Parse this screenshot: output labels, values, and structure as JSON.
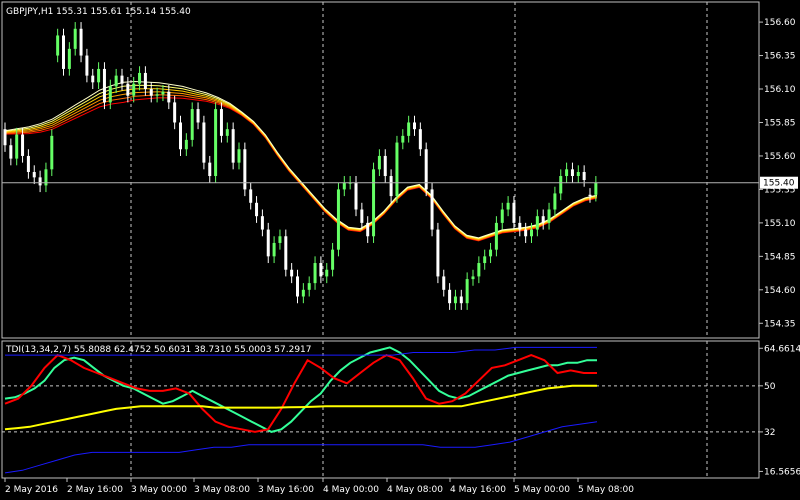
{
  "symbol_line": "GBPJPY,H1  155.31 155.61 155.14 155.40",
  "indicator_line": "TDI(13,34,2,7) 55.8088 62.4752 50.6031 38.7310 55.0003 57.2917",
  "colors": {
    "background": "#000000",
    "frame": "#c0c0c0",
    "grid": "#c8c8c8",
    "bull": "#66ff66",
    "bear": "#ffffff",
    "ribbon": [
      "#ff0000",
      "#ff6600",
      "#ff9900",
      "#ffcc00",
      "#ffff66",
      "#ffffcc"
    ],
    "tdi_green": "#33ff99",
    "tdi_red": "#ff0000",
    "tdi_yellow": "#ffff00",
    "tdi_band": "#1a1aff",
    "price_line": "#b4b4b4"
  },
  "price_axis": {
    "min": 154.24,
    "max": 156.75,
    "ticks": [
      "156.60",
      "156.35",
      "156.10",
      "155.85",
      "155.60",
      "155.35",
      "155.10",
      "154.85",
      "154.60",
      "154.35"
    ],
    "current": "155.40"
  },
  "tdi_axis": {
    "min": 14.0,
    "max": 67.5,
    "ticks": [
      "64.6614",
      "50",
      "32",
      "16.5656"
    ]
  },
  "time_labels": [
    "2 May 2016",
    "2 May 16:00",
    "3 May 00:00",
    "3 May 08:00",
    "3 May 16:00",
    "4 May 00:00",
    "4 May 08:00",
    "4 May 16:00",
    "5 May 00:00",
    "5 May 08:00"
  ],
  "chart_data": [
    {
      "type": "candlestick",
      "title": "GBPJPY,H1",
      "ylim": [
        154.24,
        156.75
      ],
      "closes": [
        155.68,
        155.58,
        155.76,
        155.6,
        155.48,
        155.44,
        155.38,
        155.5,
        155.75,
        156.5,
        156.25,
        156.4,
        156.55,
        156.35,
        156.2,
        156.15,
        156.25,
        156.0,
        156.12,
        156.2,
        156.14,
        156.05,
        156.14,
        156.22,
        156.1,
        156.05,
        156.06,
        156.08,
        156.0,
        155.85,
        155.65,
        155.72,
        155.95,
        155.85,
        155.55,
        155.45,
        155.95,
        155.75,
        155.8,
        155.55,
        155.65,
        155.35,
        155.25,
        155.15,
        155.05,
        154.85,
        154.95,
        155.0,
        154.75,
        154.7,
        154.55,
        154.6,
        154.65,
        154.8,
        154.7,
        154.75,
        154.9,
        155.35,
        155.4,
        155.4,
        155.2,
        155.1,
        155.0,
        155.5,
        155.6,
        155.45,
        155.3,
        155.7,
        155.75,
        155.85,
        155.8,
        155.65,
        155.35,
        155.05,
        154.7,
        154.6,
        154.5,
        154.55,
        154.5,
        154.68,
        154.7,
        154.8,
        154.85,
        154.9,
        155.1,
        155.2,
        155.25,
        155.1,
        155.05,
        155.0,
        155.05,
        155.15,
        155.1,
        155.2,
        155.32,
        155.45,
        155.5,
        155.45,
        155.48,
        155.42,
        155.3,
        155.4
      ],
      "opens": [
        155.8,
        155.68,
        155.58,
        155.76,
        155.6,
        155.48,
        155.44,
        155.38,
        155.5,
        156.35,
        156.5,
        156.25,
        156.4,
        156.55,
        156.35,
        156.2,
        156.15,
        156.25,
        156.0,
        156.12,
        156.2,
        156.14,
        156.05,
        156.14,
        156.22,
        156.1,
        156.05,
        156.06,
        156.08,
        156.0,
        155.85,
        155.65,
        155.72,
        155.95,
        155.85,
        155.55,
        155.45,
        155.95,
        155.75,
        155.8,
        155.55,
        155.65,
        155.35,
        155.25,
        155.15,
        155.05,
        154.85,
        154.95,
        155.0,
        154.75,
        154.7,
        154.55,
        154.6,
        154.65,
        154.8,
        154.7,
        154.75,
        154.9,
        155.35,
        155.4,
        155.4,
        155.2,
        155.1,
        155.0,
        155.5,
        155.6,
        155.45,
        155.3,
        155.7,
        155.75,
        155.85,
        155.8,
        155.65,
        155.35,
        155.05,
        154.7,
        154.6,
        154.5,
        154.55,
        154.5,
        154.68,
        154.7,
        154.8,
        154.85,
        154.9,
        155.1,
        155.2,
        155.25,
        155.1,
        155.05,
        155.0,
        155.05,
        155.15,
        155.1,
        155.2,
        155.32,
        155.45,
        155.5,
        155.45,
        155.48,
        155.31,
        155.31
      ],
      "ribbon_center": [
        155.78,
        155.79,
        155.8,
        155.82,
        155.85,
        155.9,
        155.95,
        156.0,
        156.05,
        156.08,
        156.1,
        156.11,
        156.11,
        156.11,
        156.1,
        156.09,
        156.07,
        156.05,
        156.02,
        155.98,
        155.92,
        155.85,
        155.75,
        155.62,
        155.5,
        155.4,
        155.3,
        155.2,
        155.12,
        155.06,
        155.05,
        155.1,
        155.18,
        155.28,
        155.36,
        155.38,
        155.3,
        155.18,
        155.07,
        155.0,
        154.98,
        155.01,
        155.04,
        155.05,
        155.06,
        155.08,
        155.12,
        155.18,
        155.24,
        155.28,
        155.3
      ]
    },
    {
      "type": "line",
      "title": "TDI(13,34,2,7)",
      "ylim": [
        14.0,
        67.5
      ],
      "series": [
        {
          "values": [
            45,
            45.5,
            47,
            49,
            52,
            57,
            60,
            61,
            60,
            57,
            54,
            52,
            50,
            49,
            47,
            45,
            43,
            44,
            46,
            48,
            46,
            44,
            42,
            40,
            38,
            36,
            34,
            32,
            33,
            36,
            40,
            44,
            47,
            52,
            56,
            59,
            61,
            63,
            64,
            65,
            63,
            60,
            56,
            52,
            48,
            46,
            45,
            46,
            48,
            50,
            52,
            54,
            55,
            56,
            57,
            58,
            58,
            59,
            59,
            60,
            60
          ]
        },
        {
          "values": [
            43,
            45,
            50,
            57,
            62,
            60,
            57,
            55,
            53,
            51,
            49,
            48,
            48,
            49,
            47,
            41,
            36,
            34,
            33,
            32,
            33,
            41,
            51,
            60,
            57,
            53,
            51,
            55,
            59,
            62,
            60,
            53,
            45,
            43,
            44,
            47,
            52,
            57,
            58,
            60,
            62,
            60,
            55,
            56,
            55,
            55
          ]
        },
        {
          "values": [
            33,
            33.5,
            34,
            35,
            36,
            37,
            38,
            39,
            40,
            41,
            41.5,
            42,
            42,
            42,
            42,
            42,
            42,
            41.5,
            41.5,
            41.5,
            41.5,
            41.5,
            41.5,
            41.6,
            41.7,
            41.8,
            42,
            42,
            42,
            42,
            42,
            42,
            42,
            42,
            42,
            42,
            42,
            42,
            43,
            44,
            45,
            46,
            47,
            48,
            49,
            49.5,
            50,
            50,
            50
          ]
        },
        {
          "values": [
            62,
            62,
            62,
            62,
            62,
            62,
            62,
            62,
            62,
            62,
            62,
            62,
            62,
            62,
            62,
            62,
            62,
            62,
            62,
            62,
            63,
            63,
            63,
            64,
            64,
            65,
            65,
            65,
            65,
            65
          ]
        },
        {
          "values": [
            16,
            17,
            19,
            21,
            23,
            24,
            24,
            24,
            24,
            24,
            24,
            25,
            26,
            26,
            27,
            27,
            27,
            27,
            27,
            27,
            27,
            27,
            27,
            27,
            27,
            26,
            26,
            26,
            27,
            28,
            30,
            32,
            34,
            35,
            36
          ]
        }
      ]
    }
  ]
}
